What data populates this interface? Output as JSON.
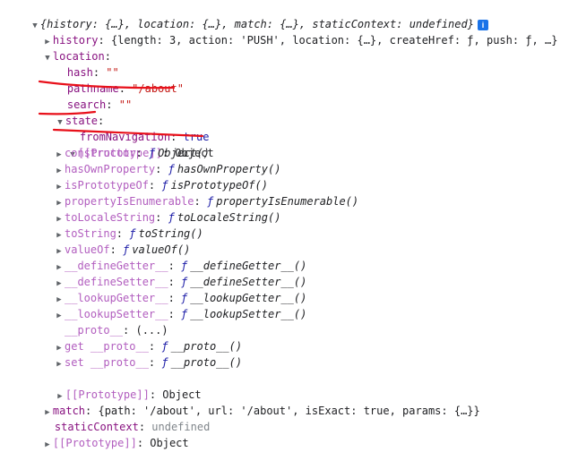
{
  "summary": {
    "text": "{history: {…}, location: {…}, match: {…}, staticContext: undefined}",
    "info_badge": "i"
  },
  "history": {
    "key": "history",
    "preview": "{length: 3, action: 'PUSH', location: {…}, createHref: ƒ, push: ƒ, …}"
  },
  "location": {
    "key": "location",
    "hash_key": "hash",
    "hash_value": "\"\"",
    "pathname_key": "pathname",
    "pathname_value": "\"/about\"",
    "search_key": "search",
    "search_value": "\"\"",
    "state_key": "state",
    "fromNavigation_key": "fromNavigation",
    "fromNavigation_value": "true",
    "proto_key": "[[Prototype]]",
    "proto_value": "Object",
    "outer_proto_key": "[[Prototype]]",
    "outer_proto_value": "Object"
  },
  "prototype_members": [
    {
      "key": "constructor",
      "label": "ƒ",
      "value": "Object()"
    },
    {
      "key": "hasOwnProperty",
      "label": "ƒ",
      "value": "hasOwnProperty()"
    },
    {
      "key": "isPrototypeOf",
      "label": "ƒ",
      "value": "isPrototypeOf()"
    },
    {
      "key": "propertyIsEnumerable",
      "label": "ƒ",
      "value": "propertyIsEnumerable()"
    },
    {
      "key": "toLocaleString",
      "label": "ƒ",
      "value": "toLocaleString()"
    },
    {
      "key": "toString",
      "label": "ƒ",
      "value": "toString()"
    },
    {
      "key": "valueOf",
      "label": "ƒ",
      "value": "valueOf()"
    },
    {
      "key": "__defineGetter__",
      "label": "ƒ",
      "value": "__defineGetter__()"
    },
    {
      "key": "__defineSetter__",
      "label": "ƒ",
      "value": "__defineSetter__()"
    },
    {
      "key": "__lookupGetter__",
      "label": "ƒ",
      "value": "__lookupGetter__()"
    },
    {
      "key": "__lookupSetter__",
      "label": "ƒ",
      "value": "__lookupSetter__()"
    },
    {
      "key": "__proto__",
      "label": "",
      "value": "(...)"
    },
    {
      "key": "get __proto__",
      "label": "ƒ",
      "value": "__proto__()"
    },
    {
      "key": "set __proto__",
      "label": "ƒ",
      "value": "__proto__()"
    }
  ],
  "match": {
    "key": "match",
    "preview": "{path: '/about', url: '/about', isExact: true, params: {…}}"
  },
  "staticContext": {
    "key": "staticContext",
    "value": "undefined"
  },
  "root_proto": {
    "key": "[[Prototype]]",
    "value": "Object"
  },
  "icons": {
    "expanded": "▼",
    "collapsed": "▶"
  },
  "colors": {
    "key": "#881280",
    "string": "#c41a16",
    "number_bool": "#1a1aa6",
    "undefined": "#80868b",
    "annotation": "#e8101a"
  }
}
